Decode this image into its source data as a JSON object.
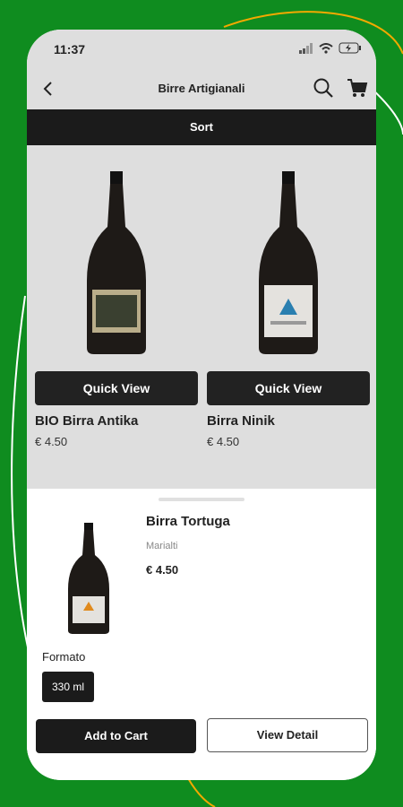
{
  "status": {
    "time": "11:37"
  },
  "header": {
    "title": "Birre Artigianali"
  },
  "sort": {
    "label": "Sort"
  },
  "products": [
    {
      "name": "BIO Birra Antika",
      "price": "€ 4.50",
      "quick_view": "Quick View"
    },
    {
      "name": "Birra Ninik",
      "price": "€ 4.50",
      "quick_view": "Quick View"
    }
  ],
  "sheet": {
    "name": "Birra Tortuga",
    "brand": "Marialti",
    "price": "€ 4.50",
    "format_label": "Formato",
    "format_option": "330 ml",
    "add_to_cart": "Add to Cart",
    "view_detail": "View Detail"
  },
  "colors": {
    "background": "#0f8c1f",
    "dark": "#1b1b1b",
    "accent_line": "#f2a900"
  }
}
